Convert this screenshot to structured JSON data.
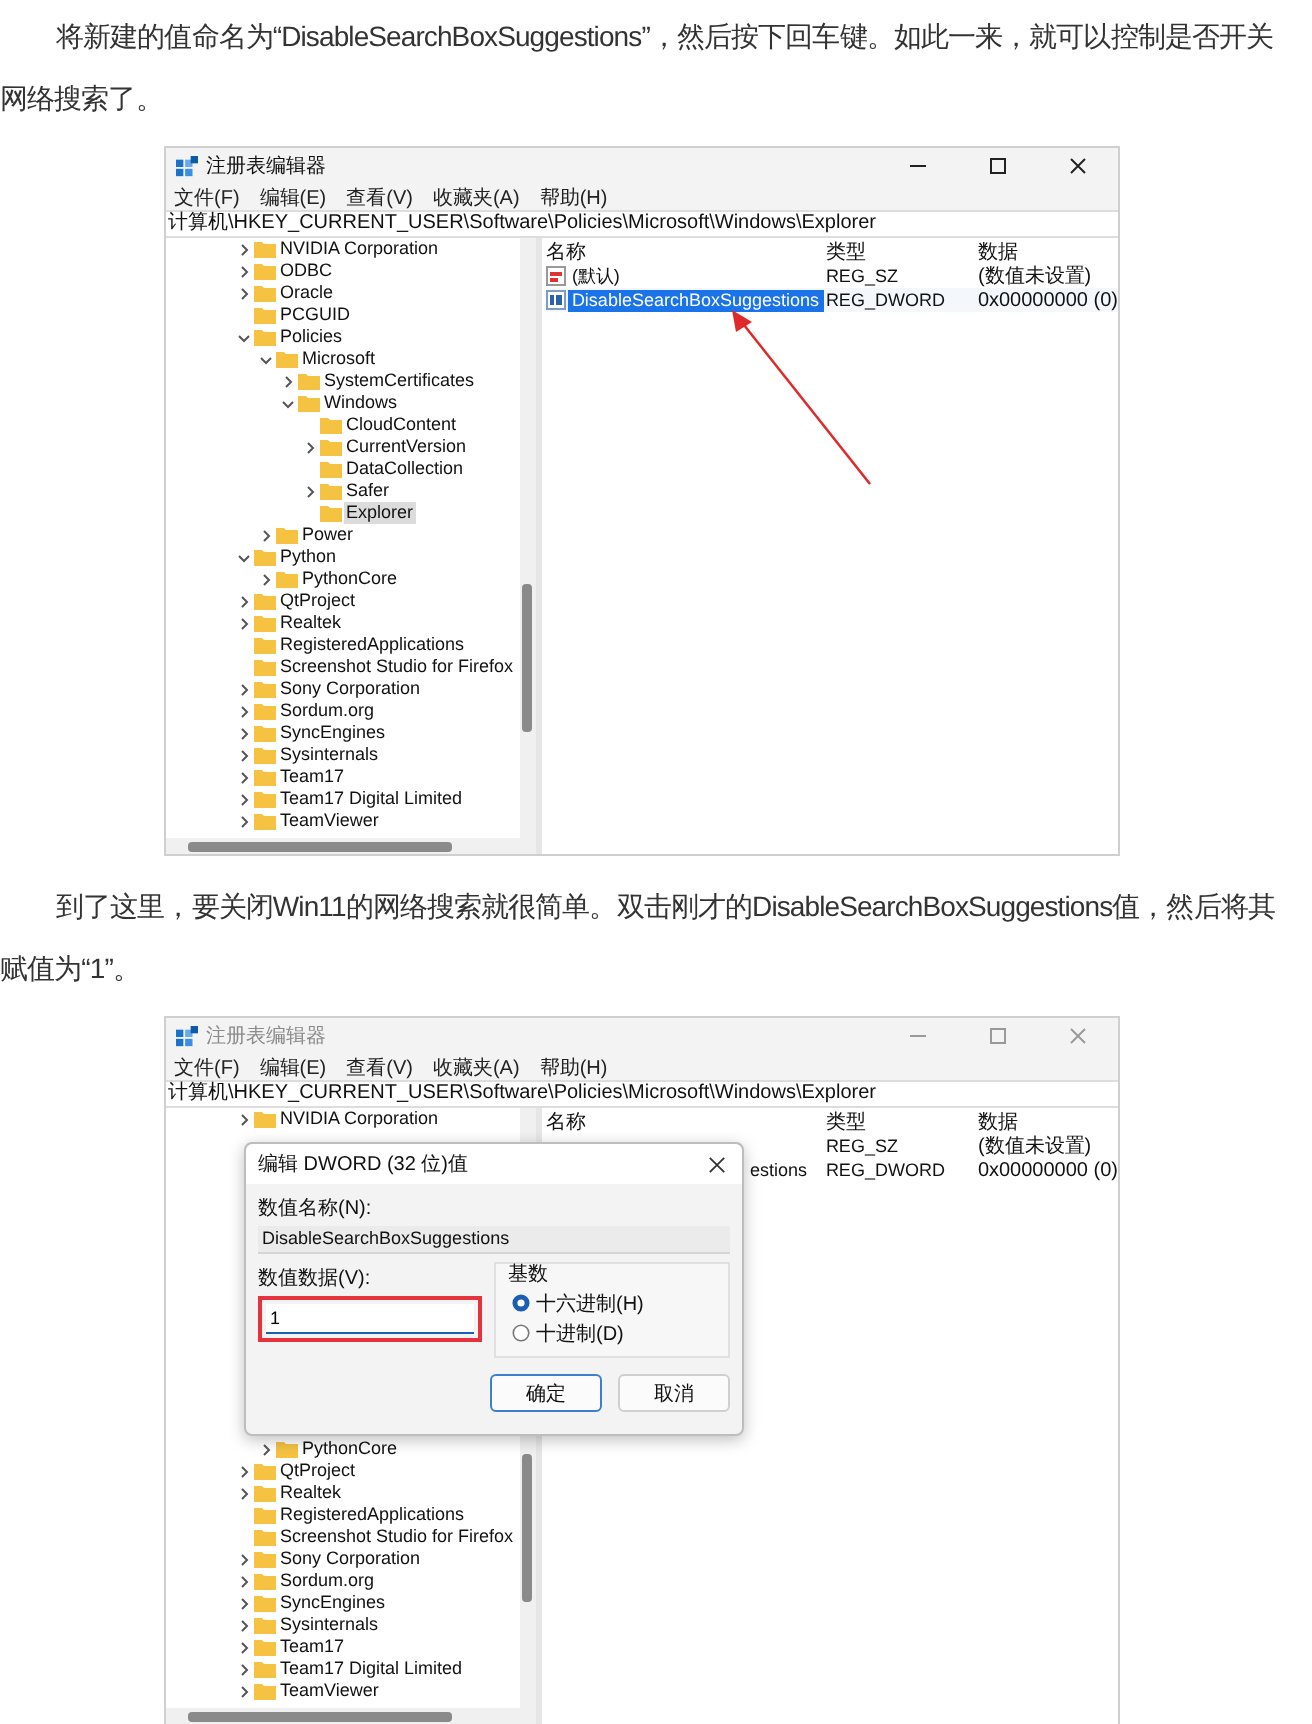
{
  "content": [
    {
      "kind": "paragraph",
      "text": "将新建的值命名为“DisableSearchBoxSuggestions”，然后按下回车键。如此一来，就可以控制是否开关网络搜索了。"
    },
    {
      "kind": "screenshot",
      "window": {
        "title": "注册表编辑器",
        "active": true,
        "menu": [
          "文件(F)",
          "编辑(E)",
          "查看(V)",
          "收藏夹(A)",
          "帮助(H)"
        ],
        "address": "计算机\\HKEY_CURRENT_USER\\Software\\Policies\\Microsoft\\Windows\\Explorer",
        "arrow": true,
        "tree": [
          {
            "name": "NVIDIA Corporation",
            "has_children": true,
            "expanded": false,
            "selected": false
          },
          {
            "name": "ODBC",
            "has_children": true,
            "expanded": false,
            "selected": false
          },
          {
            "name": "Oracle",
            "has_children": true,
            "expanded": false,
            "selected": false
          },
          {
            "name": "PCGUID",
            "has_children": false,
            "selected": false
          },
          {
            "name": "Policies",
            "has_children": true,
            "expanded": true,
            "selected": false,
            "children": [
              {
                "name": "Microsoft",
                "has_children": true,
                "expanded": true,
                "selected": false,
                "children": [
                  {
                    "name": "SystemCertificates",
                    "has_children": true,
                    "expanded": false,
                    "selected": false
                  },
                  {
                    "name": "Windows",
                    "has_children": true,
                    "expanded": true,
                    "selected": false,
                    "children": [
                      {
                        "name": "CloudContent",
                        "has_children": false,
                        "selected": false
                      },
                      {
                        "name": "CurrentVersion",
                        "has_children": true,
                        "expanded": false,
                        "selected": false
                      },
                      {
                        "name": "DataCollection",
                        "has_children": false,
                        "selected": false
                      },
                      {
                        "name": "Safer",
                        "has_children": true,
                        "expanded": false,
                        "selected": false
                      },
                      {
                        "name": "Explorer",
                        "has_children": false,
                        "selected": true
                      }
                    ]
                  }
                ]
              },
              {
                "name": "Power",
                "has_children": true,
                "expanded": false,
                "selected": false
              }
            ]
          },
          {
            "name": "Python",
            "has_children": true,
            "expanded": true,
            "selected": false,
            "children": [
              {
                "name": "PythonCore",
                "has_children": true,
                "expanded": false,
                "selected": false
              }
            ]
          },
          {
            "name": "QtProject",
            "has_children": true,
            "expanded": false,
            "selected": false
          },
          {
            "name": "Realtek",
            "has_children": true,
            "expanded": false,
            "selected": false
          },
          {
            "name": "RegisteredApplications",
            "has_children": false,
            "selected": false
          },
          {
            "name": "Screenshot Studio for Firefox",
            "has_children": false,
            "selected": false
          },
          {
            "name": "Sony Corporation",
            "has_children": true,
            "expanded": false,
            "selected": false
          },
          {
            "name": "Sordum.org",
            "has_children": true,
            "expanded": false,
            "selected": false
          },
          {
            "name": "SyncEngines",
            "has_children": true,
            "expanded": false,
            "selected": false
          },
          {
            "name": "Sysinternals",
            "has_children": true,
            "expanded": false,
            "selected": false
          },
          {
            "name": "Team17",
            "has_children": true,
            "expanded": false,
            "selected": false
          },
          {
            "name": "Team17 Digital Limited",
            "has_children": true,
            "expanded": false,
            "selected": false
          },
          {
            "name": "TeamViewer",
            "has_children": true,
            "expanded": false,
            "selected": false
          }
        ],
        "columns": [
          "名称",
          "类型",
          "数据"
        ],
        "values": [
          {
            "kind": "string",
            "name": "(默认)",
            "type": "REG_SZ",
            "data": "(数值未设置)",
            "selected": false
          },
          {
            "kind": "dword",
            "name": "DisableSearchBoxSuggestions",
            "type": "REG_DWORD",
            "data": "0x00000000 (0)",
            "selected": true
          }
        ]
      }
    },
    {
      "kind": "paragraph",
      "text": "到了这里，要关闭Win11的网络搜索就很简单。双击刚才的DisableSearchBoxSuggestions值，然后将其赋值为“1”。"
    },
    {
      "kind": "screenshot",
      "window": {
        "title": "注册表编辑器",
        "active": false,
        "menu": [
          "文件(F)",
          "编辑(E)",
          "查看(V)",
          "收藏夹(A)",
          "帮助(H)"
        ],
        "address": "计算机\\HKEY_CURRENT_USER\\Software\\Policies\\Microsoft\\Windows\\Explorer",
        "tree": [
          {
            "name": "NVIDIA Corporation",
            "has_children": true,
            "expanded": false,
            "selected": false
          }
        ],
        "tree_after_dialog": [
          {
            "children": [
              {
                "name": "PythonCore",
                "has_children": true,
                "expanded": false,
                "selected": false
              }
            ]
          },
          {
            "name": "QtProject",
            "has_children": true,
            "expanded": false,
            "selected": false
          },
          {
            "name": "Realtek",
            "has_children": true,
            "expanded": false,
            "selected": false
          },
          {
            "name": "RegisteredApplications",
            "has_children": false,
            "selected": false
          },
          {
            "name": "Screenshot Studio for Firefox",
            "has_children": false,
            "selected": false
          },
          {
            "name": "Sony Corporation",
            "has_children": true,
            "expanded": false,
            "selected": false
          },
          {
            "name": "Sordum.org",
            "has_children": true,
            "expanded": false,
            "selected": false
          },
          {
            "name": "SyncEngines",
            "has_children": true,
            "expanded": false,
            "selected": false
          },
          {
            "name": "Sysinternals",
            "has_children": true,
            "expanded": false,
            "selected": false
          },
          {
            "name": "Team17",
            "has_children": true,
            "expanded": false,
            "selected": false
          },
          {
            "name": "Team17 Digital Limited",
            "has_children": true,
            "expanded": false,
            "selected": false
          },
          {
            "name": "TeamViewer",
            "has_children": true,
            "expanded": false,
            "selected": false
          }
        ],
        "columns": [
          "名称",
          "类型",
          "数据"
        ],
        "values": [
          {
            "type": "REG_SZ",
            "data": "(数值未设置)"
          },
          {
            "name": "estions",
            "type": "REG_DWORD",
            "data": "0x00000000 (0)",
            "selected": false
          }
        ],
        "dialog": {
          "title": "编辑 DWORD (32 位)值",
          "name_label": "数值名称(N):",
          "name_value": "DisableSearchBoxSuggestions",
          "data_label": "数值数据(V):",
          "data_value": "1",
          "highlighted": true,
          "base_label": "基数",
          "bases": [
            {
              "label": "十六进制(H)",
              "selected": true
            },
            {
              "label": "十进制(D)",
              "selected": false
            }
          ],
          "buttons": [
            {
              "label": "确定",
              "default": true
            },
            {
              "label": "取消",
              "default": false
            }
          ]
        }
      }
    }
  ]
}
